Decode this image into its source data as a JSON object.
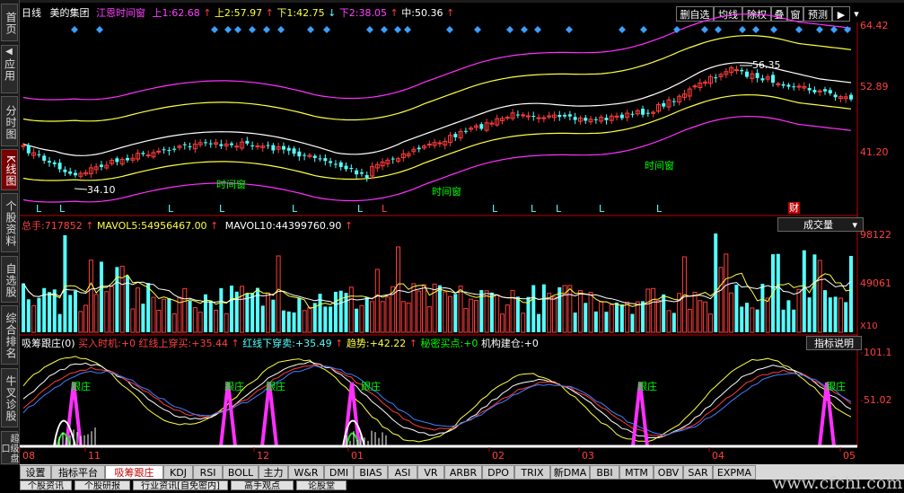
{
  "colors": {
    "up": "#ff3c3c",
    "down": "#54ffff",
    "ma1": "#ffffff",
    "ma2": "#ffff40",
    "band": "#ff30ff",
    "green": "#00ff00",
    "panelRed": "#ff4040"
  },
  "sidebar": {
    "items": [
      "首页",
      "应用",
      "分时图",
      "K线图",
      "个股资料",
      "自选股",
      "综合排名",
      "牛叉诊股",
      "超级盘口"
    ],
    "active_index": 3
  },
  "header": {
    "period": "日线",
    "stock": "美的集团",
    "indicator": "江恩时间窗",
    "up1_label": "上1:",
    "up1_value": "62.68",
    "up2_label": "上2:",
    "up2_value": "57.97",
    "down1_label": "下1:",
    "down1_value": "42.75",
    "down2_label": "下2:",
    "down2_value": "38.05",
    "mid_label": "中:",
    "mid_value": "50.36"
  },
  "toolbar": {
    "self_select": "删自选",
    "ma": "均线",
    "rights": "除权",
    "overlay": "叠",
    "window": "窗",
    "warning": "预测",
    "arrow_icon": "play-icon",
    "dropdown_icon": "chevron-down-icon"
  },
  "price_axis": {
    "ticks": [
      "64.42",
      "52.89",
      "41.20"
    ]
  },
  "price_chart": {
    "high_label": "56.35",
    "low_label": "34.10",
    "time_window_labels": [
      "时间窗",
      "时间窗",
      "时间窗"
    ],
    "l_markers": [
      "L",
      "L",
      "L",
      "L",
      "L",
      "L",
      "L",
      "L",
      "L",
      "L",
      "L",
      "L",
      "L"
    ],
    "finance_marker": "财"
  },
  "volume": {
    "label": "总手:",
    "value": "717852",
    "mavol5_label": "MAVOL5:",
    "mavol5_value": "54956467.00",
    "mavol10_label": "MAVOL10:",
    "mavol10_value": "44399760.90",
    "dropdown": "成交量",
    "axis": [
      "98122",
      "49061",
      "X10"
    ]
  },
  "indicator": {
    "name": "吸筹跟庄(0)",
    "buy_label": "买入时机:",
    "buy_value": "+0",
    "red_up_label": "红线上穿买:",
    "red_up_value": "+35.44",
    "red_down_label": "红线下穿卖:",
    "red_down_value": "+35.49",
    "trend_label": "趋势:",
    "trend_value": "+42.22",
    "secret_label": "秘密买点:",
    "secret_value": "+0",
    "inst_label": "机构建仓:",
    "inst_value": "+0",
    "help": "指标说明",
    "axis": [
      "101.1",
      "51.02"
    ],
    "follow_label": "跟庄"
  },
  "xaxis": {
    "labels": [
      "08",
      "11",
      "12",
      "01",
      "02",
      "03",
      "04",
      "05"
    ]
  },
  "tabs": [
    "设置",
    "指标平台",
    "吸筹跟庄",
    "KDJ",
    "RSI",
    "BOLL",
    "主力",
    "W&R",
    "DMI",
    "BIAS",
    "ASI",
    "VR",
    "ARBR",
    "DPO",
    "TRIX",
    "新DMA",
    "BBI",
    "MTM",
    "OBV",
    "SAR",
    "EXPMA"
  ],
  "active_tab": 2,
  "bottom_tabs": [
    "个股资讯",
    "个股研报",
    "行业资讯[自免密内]",
    "高手观点",
    "论股堂"
  ],
  "watermark": "www.cfchi.com"
}
